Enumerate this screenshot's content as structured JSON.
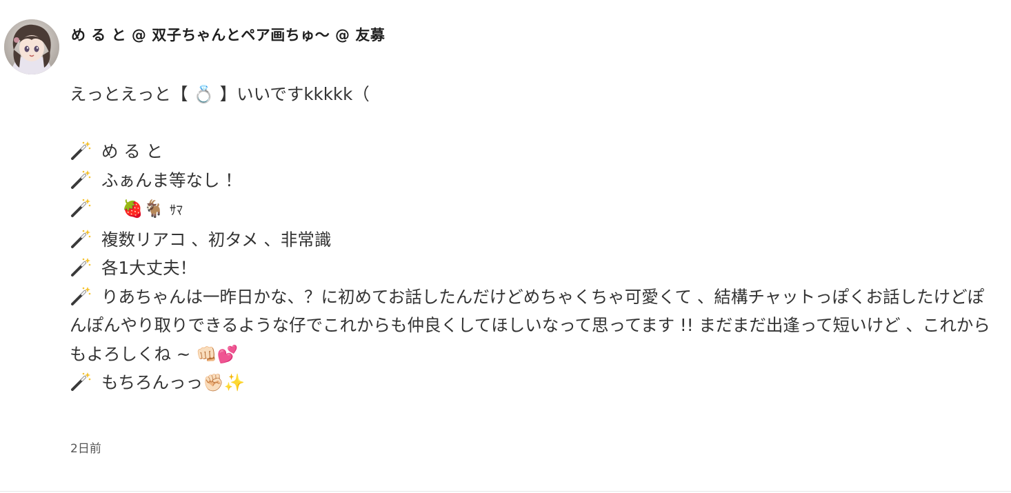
{
  "post": {
    "author_name": "め る と @ 双子ちゃんとペア画ちゅ〜 @ 友募",
    "avatar_icon": "avatar-image",
    "timestamp": "2日前",
    "body": {
      "intro": {
        "before": "えっとえっと【 ",
        "emoji": "💍",
        "after": " 】いいですkkkkk（"
      },
      "items": [
        {
          "icon": "magic-wand-icon",
          "text": "め る と"
        },
        {
          "icon": "magic-wand-icon",
          "text": "ふぁんま等なし ！"
        },
        {
          "icon": "magic-wand-icon",
          "emoji1": "🍓",
          "emoji2": "🐐",
          "text": "ｻﾏ"
        },
        {
          "icon": "magic-wand-icon",
          "text": "複数リアコ 、初タメ 、非常識"
        },
        {
          "icon": "magic-wand-icon",
          "text": "各1大丈夫！"
        },
        {
          "icon": "magic-wand-icon",
          "text": "りあちゃんは一昨日かな、？に初めてお話したんだけどめちゃくちゃ可愛くて 、結構チャットっぽくお話したけどぽんぽんやり取りできるような仔でこれからも仲良くしてほしいなって思ってます !! まだまだ出逢って短いけど 、これからもよろしくね ~",
          "emoji1": "👊🏻",
          "emoji2": "💕"
        },
        {
          "icon": "magic-wand-icon",
          "text": "もちろんっっ",
          "emoji1": "✊🏻",
          "emoji2": "✨"
        }
      ]
    }
  },
  "colors": {
    "text": "#333333",
    "name": "#1f1f1f",
    "timestamp": "#555555",
    "divider": "#e6e6e6"
  }
}
